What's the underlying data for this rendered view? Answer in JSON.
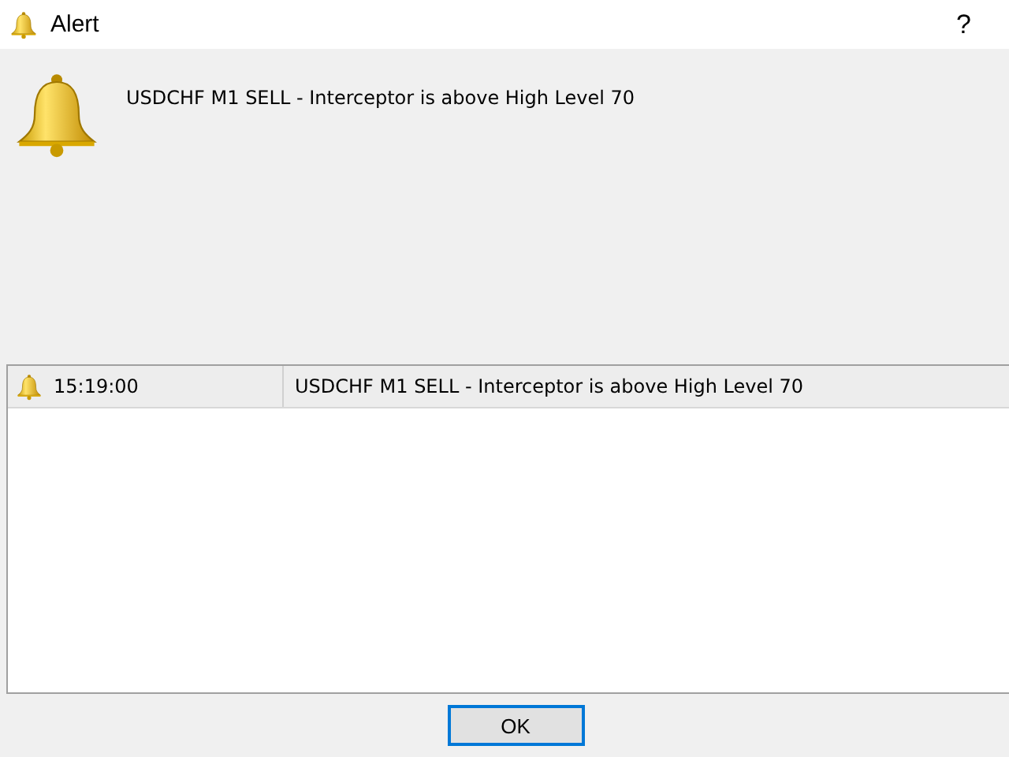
{
  "window": {
    "title": "Alert",
    "help": "?"
  },
  "message": "USDCHF M1 SELL - Interceptor is above High Level 70",
  "alerts": [
    {
      "time": "15:19:00",
      "text": "USDCHF M1 SELL - Interceptor is above High Level 70"
    }
  ],
  "buttons": [
    "OK"
  ]
}
